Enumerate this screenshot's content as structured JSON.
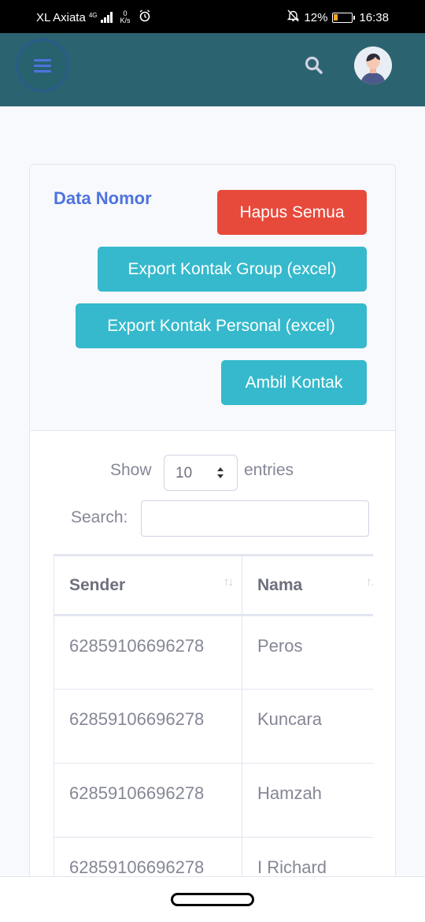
{
  "statusbar": {
    "carrier": "XL Axiata",
    "network": "4G",
    "speed_value": "0",
    "speed_unit": "K/s",
    "battery": "12%",
    "time": "16:38"
  },
  "card": {
    "title": "Data Nomor",
    "buttons": {
      "delete_all": "Hapus Semua",
      "export_group": "Export Kontak Group (excel)",
      "export_personal": "Export Kontak Personal (excel)",
      "fetch_contacts": "Ambil Kontak"
    },
    "length": {
      "show": "Show",
      "value": "10",
      "entries": "entries"
    },
    "search_label": "Search:",
    "search_value": ""
  },
  "table": {
    "columns": [
      "Sender",
      "Nama"
    ],
    "rows": [
      [
        "62859106696278",
        "Peros"
      ],
      [
        "62859106696278",
        "Kuncara"
      ],
      [
        "62859106696278",
        "Hamzah"
      ],
      [
        "62859106696278",
        "I Richard"
      ]
    ]
  },
  "colors": {
    "topbar": "#2c6370",
    "primary": "#4e73df",
    "danger": "#e74a3b",
    "info": "#36b9cc"
  }
}
